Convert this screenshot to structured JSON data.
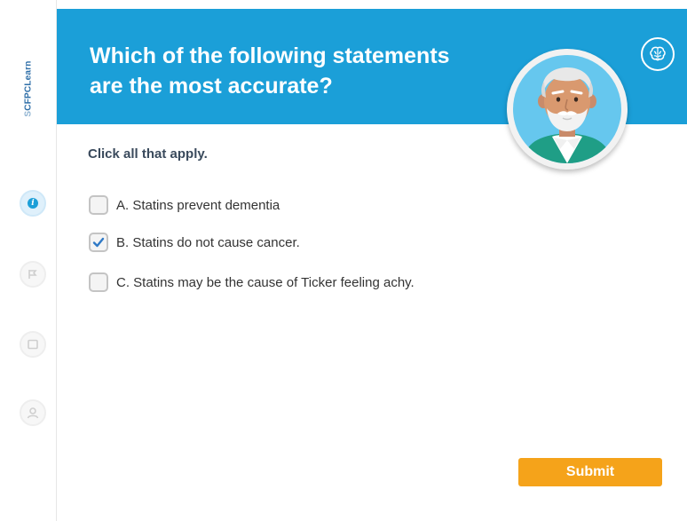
{
  "brand": {
    "logo_text": "CFPCLearn",
    "logo_mark": "S"
  },
  "question": {
    "title_line1": "Which of the following statements",
    "title_line2": "are the most accurate?"
  },
  "instruction": "Click all that apply.",
  "options": [
    {
      "label": "A. Statins prevent dementia",
      "checked": false
    },
    {
      "label": "B. Statins do not cause cancer.",
      "checked": true
    },
    {
      "label": "C. Statins may be the cause of Ticker feeling achy.",
      "checked": false
    }
  ],
  "submit_label": "Submit",
  "sidebar": {
    "icons": [
      "info-icon",
      "flag-icon",
      "note-icon",
      "user-icon"
    ],
    "info_glyph": "i"
  },
  "header_icons": [
    "brain-icon"
  ],
  "colors": {
    "header_bg": "#1b9fd8",
    "submit_bg": "#f5a31a",
    "check_color": "#2f79c6",
    "text_dark": "#333333"
  }
}
